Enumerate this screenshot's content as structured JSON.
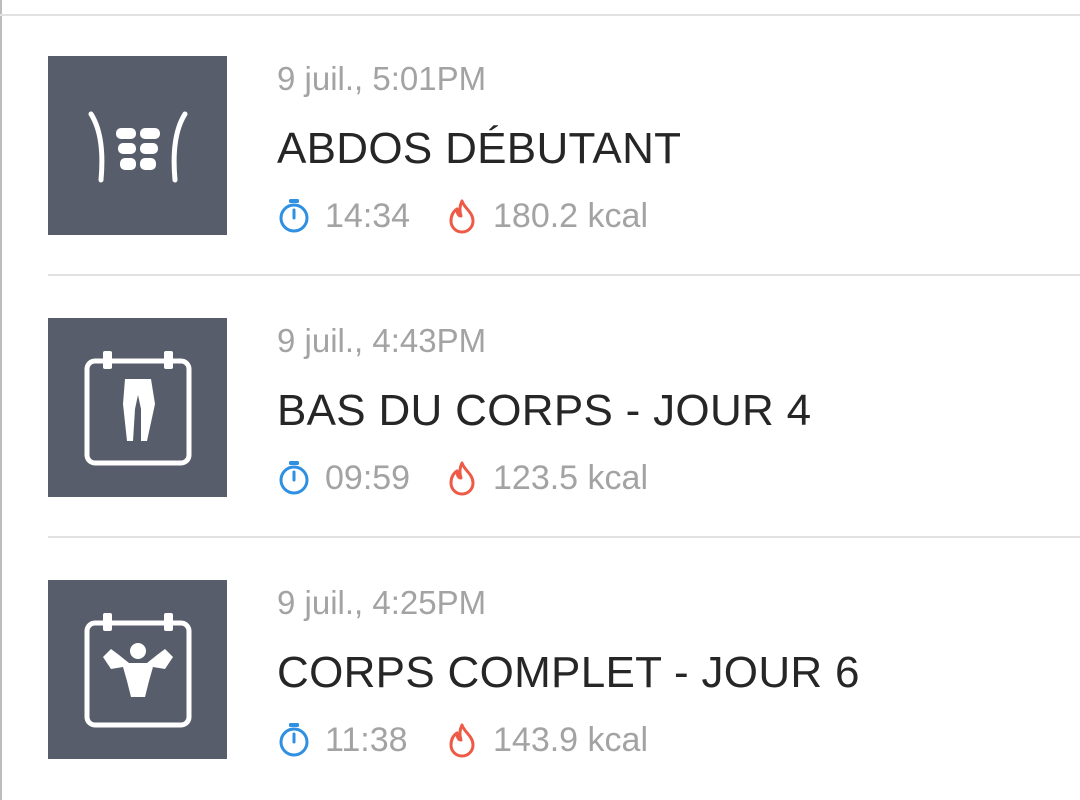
{
  "workouts": [
    {
      "datetime": "9 juil., 5:01PM",
      "title": "ABDOS DÉBUTANT",
      "duration": "14:34",
      "calories": "180.2 kcal",
      "icon": "abs-icon"
    },
    {
      "datetime": "9 juil., 4:43PM",
      "title": "BAS DU CORPS - JOUR 4",
      "duration": "09:59",
      "calories": "123.5 kcal",
      "icon": "calendar-legs-icon"
    },
    {
      "datetime": "9 juil., 4:25PM",
      "title": "CORPS COMPLET - JOUR 6",
      "duration": "11:38",
      "calories": "143.9 kcal",
      "icon": "calendar-full-body-icon"
    }
  ],
  "colors": {
    "thumbnail_bg": "#575d6b",
    "timer_icon": "#2f8fe0",
    "flame_icon": "#ee5a45",
    "title_text": "#262626",
    "secondary_text": "#a3a3a3"
  }
}
